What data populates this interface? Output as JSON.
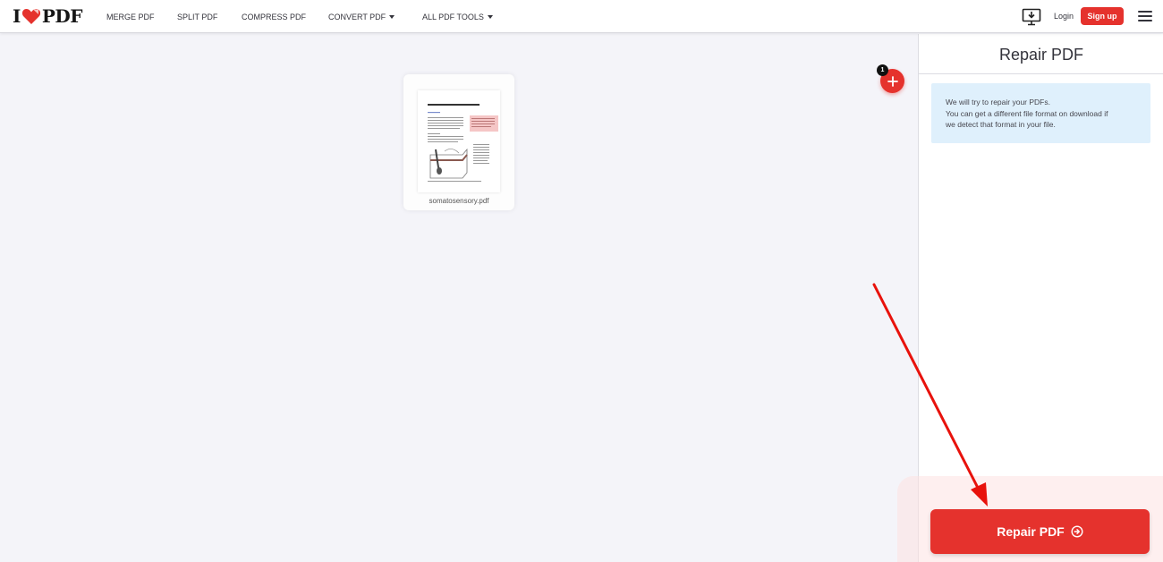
{
  "header": {
    "logo": {
      "left": "I",
      "right": "PDF"
    },
    "nav": [
      {
        "label": "MERGE PDF",
        "has_dropdown": false
      },
      {
        "label": "SPLIT PDF",
        "has_dropdown": false
      },
      {
        "label": "COMPRESS PDF",
        "has_dropdown": false
      },
      {
        "label": "CONVERT PDF",
        "has_dropdown": true
      },
      {
        "label": "ALL PDF TOOLS",
        "has_dropdown": true
      }
    ],
    "desktop_icon": "download-desktop-icon",
    "login_label": "Login",
    "signup_label": "Sign up",
    "menu_icon": "hamburger-menu-icon"
  },
  "workspace": {
    "files": [
      {
        "name": "somatosensory.pdf",
        "thumbnail_title": "Anatomy of the Somatosensory System"
      }
    ],
    "file_count": "1",
    "add_icon": "plus-icon"
  },
  "sidebar": {
    "title": "Repair PDF",
    "info_lines": [
      "We will try to repair your PDFs.",
      "You can get a different file format on download if",
      "we detect that format in your file."
    ],
    "action_label": "Repair PDF",
    "action_icon": "arrow-right-circle-icon"
  },
  "colors": {
    "brand_red": "#e5322d",
    "info_bg": "#dff0fc",
    "workspace_bg": "#f4f4f9",
    "annotation_arrow": "#e8120c"
  }
}
